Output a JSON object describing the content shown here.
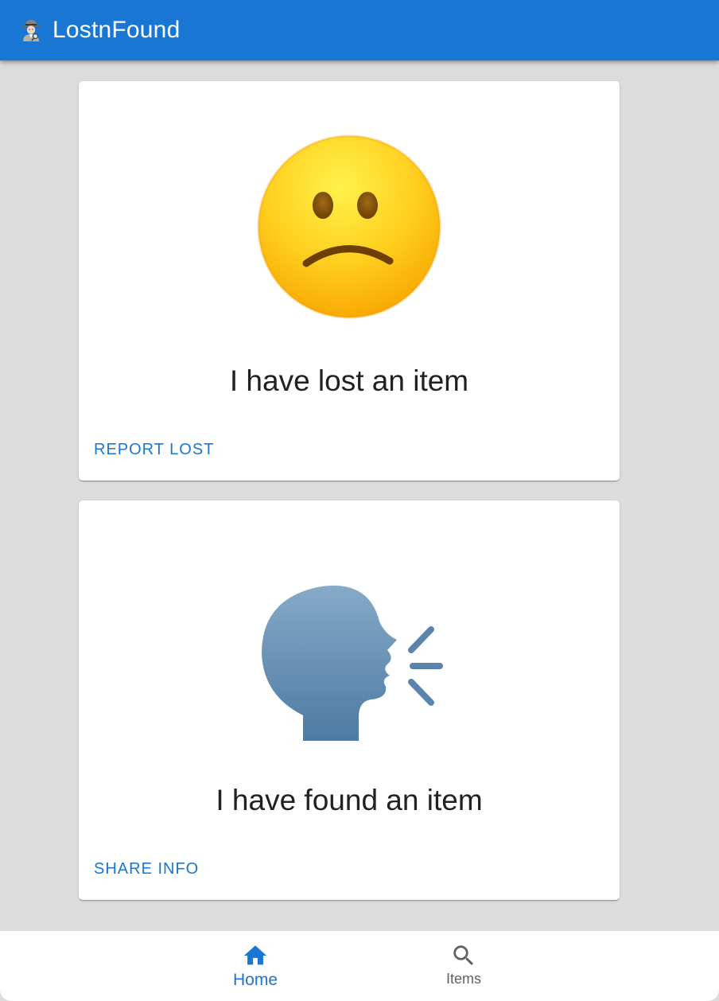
{
  "app_bar": {
    "title": "LostnFound",
    "logo_icon": "detective-icon",
    "color": "#1976d2"
  },
  "cards": [
    {
      "icon": "slightly-frowning-face-icon",
      "title": "I have lost an item",
      "action_label": "REPORT LOST"
    },
    {
      "icon": "speaking-head-icon",
      "title": "I have found an item",
      "action_label": "SHARE INFO"
    }
  ],
  "bottom_nav": {
    "items": [
      {
        "label": "Home",
        "icon": "home-icon",
        "active": true
      },
      {
        "label": "Items",
        "icon": "search-icon",
        "active": false
      }
    ]
  },
  "colors": {
    "primary": "#1976d2",
    "background": "#dcdcdc",
    "card": "#ffffff",
    "inactive_nav": "#616161"
  }
}
